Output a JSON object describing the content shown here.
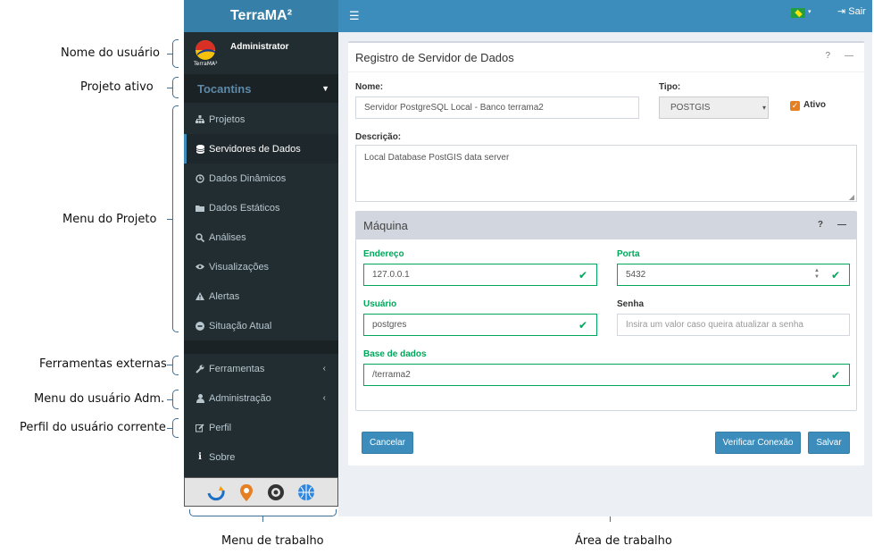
{
  "annotations": {
    "user_name": "Nome do usuário",
    "active_project": "Projeto  ativo",
    "project_menu": "Menu do Projeto",
    "external_tools": "Ferramentas  externas",
    "admin_menu": "Menu do usuário  Adm.",
    "current_profile": "Perfil do usuário  corrente",
    "work_menu": "Menu de trabalho",
    "work_area": "Área de trabalho"
  },
  "sidebar": {
    "app_title": "TerraMA²",
    "user_name": "Administrator",
    "project": "Tocantins",
    "items": [
      {
        "label": "Projetos",
        "icon": "sitemap-icon"
      },
      {
        "label": "Servidores de Dados",
        "icon": "database-icon"
      },
      {
        "label": "Dados Dinâmicos",
        "icon": "clock-icon"
      },
      {
        "label": "Dados Estáticos",
        "icon": "folder-icon"
      },
      {
        "label": "Análises",
        "icon": "search-icon"
      },
      {
        "label": "Visualizações",
        "icon": "eye-icon"
      },
      {
        "label": "Alertas",
        "icon": "warning-icon"
      },
      {
        "label": "Situação Atual",
        "icon": "minus-circle-icon"
      }
    ],
    "tools": "Ferramentas",
    "admin": "Administração",
    "profile": "Perfil",
    "about": "Sobre"
  },
  "topbar": {
    "logout": "Sair"
  },
  "form": {
    "title": "Registro de Servidor de Dados",
    "name_label": "Nome:",
    "name_value": "Servidor PostgreSQL Local - Banco terrama2",
    "type_label": "Tipo:",
    "type_value": "POSTGIS",
    "active_label": "Ativo",
    "description_label": "Descrição:",
    "description_value": "Local Database PostGIS data server",
    "machine_title": "Máquina",
    "address_label": "Endereço",
    "address_value": "127.0.0.1",
    "port_label": "Porta",
    "port_value": "5432",
    "user_label": "Usuário",
    "user_value": "postgres",
    "password_label": "Senha",
    "password_placeholder": "Insira um valor caso queira atualizar a senha",
    "database_label": "Base de dados",
    "database_value": "/terrama2",
    "cancel": "Cancelar",
    "verify": "Verificar Conexão",
    "save": "Salvar"
  }
}
